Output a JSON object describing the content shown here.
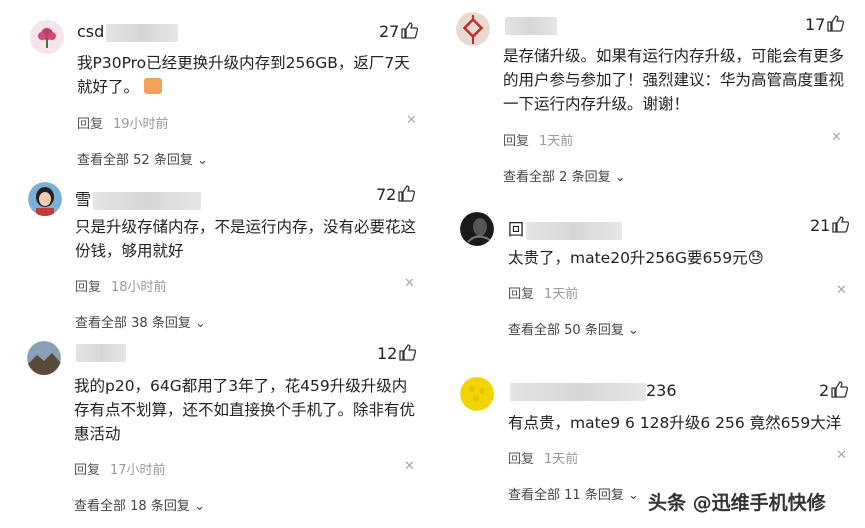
{
  "reply_label": "回复",
  "view_all_prefix": "查看全部",
  "view_all_suffix": "条回复",
  "comments": [
    {
      "name": "csd",
      "likes": "27",
      "text": "我P30Pro已经更换升级内存到256GB，返厂7天就好了。",
      "time": "19小时前",
      "reply_count": "52",
      "avatar": "flower-avatar"
    },
    {
      "name": "雪",
      "likes": "72",
      "text": "只是升级存储内存，不是运行内存，没有必要花这份钱，够用就好",
      "time": "18小时前",
      "reply_count": "38",
      "avatar": "woman-avatar"
    },
    {
      "name": "",
      "likes": "12",
      "text": "我的p20，64G都用了3年了，花459升级升级内存有点不划算，还不如直接换个手机了。除非有优惠活动",
      "time": "17小时前",
      "reply_count": "18",
      "avatar": "landscape-avatar"
    },
    {
      "name": "",
      "likes": "17",
      "text": "是存储升级。如果有运行内存升级，可能会有更多的用户参与参加了！强烈建议：华为高管高度重视一下运行内存升级。谢谢！",
      "time": "1天前",
      "reply_count": "2",
      "avatar": "knot-avatar"
    },
    {
      "name": "回",
      "likes": "21",
      "text": "太贵了，mate20升256G要659元😓",
      "time": "1天前",
      "reply_count": "50",
      "avatar": "dark-avatar"
    },
    {
      "name": "",
      "name_suffix": "236",
      "likes": "2",
      "text": "有点贵，mate9 6 128升级6 256 竟然659大洋",
      "time": "1天前",
      "reply_count": "11",
      "avatar": "yellow-avatar"
    }
  ],
  "watermark": "头条 @迅维手机快修"
}
